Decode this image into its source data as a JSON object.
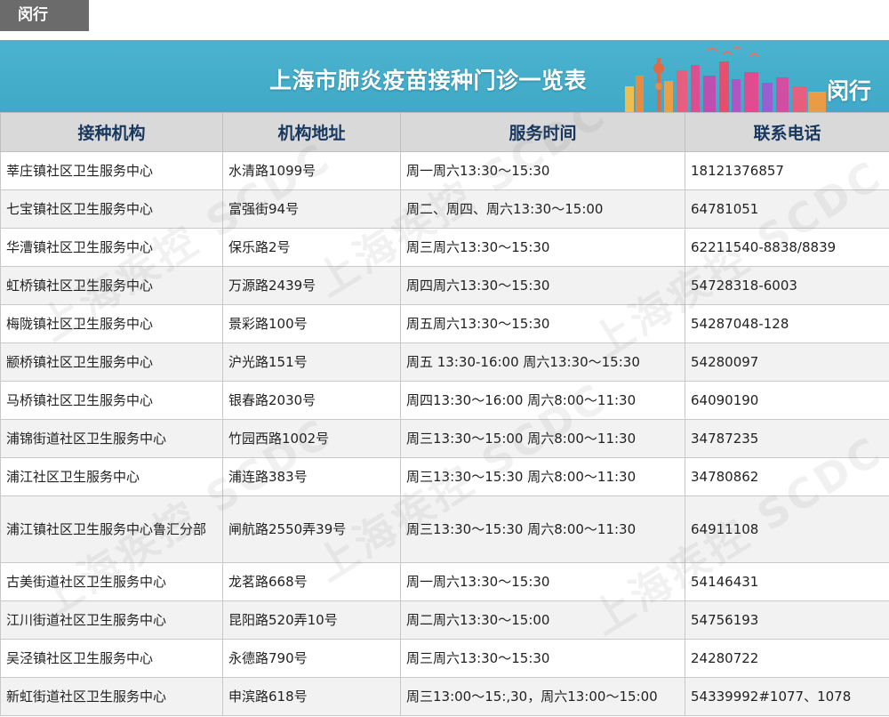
{
  "tag": {
    "label": "闵行"
  },
  "banner": {
    "title": "上海市肺炎疫苗接种门诊一览表",
    "district": "闵行"
  },
  "table": {
    "headers": [
      "接种机构",
      "机构地址",
      "服务时间",
      "联系电话"
    ],
    "rows": [
      [
        "莘庄镇社区卫生服务中心",
        "水清路1099号",
        "周一周六13:30～15:30",
        "18121376857"
      ],
      [
        "七宝镇社区卫生服务中心",
        "富强街94号",
        "周二、周四、周六13:30～15:00",
        "64781051"
      ],
      [
        "华漕镇社区卫生服务中心",
        "保乐路2号",
        "周三周六13:30～15:30",
        "62211540-8838/8839"
      ],
      [
        "虹桥镇社区卫生服务中心",
        "万源路2439号",
        "周四周六13:30～15:30",
        "54728318-6003"
      ],
      [
        "梅陇镇社区卫生服务中心",
        "景彩路100号",
        "周五周六13:30～15:30",
        "54287048-128"
      ],
      [
        "颛桥镇社区卫生服务中心",
        "沪光路151号",
        "周五 13:30-16:00 周六13:30～15:30",
        "54280097"
      ],
      [
        "马桥镇社区卫生服务中心",
        "银春路2030号",
        "周四13:30～16:00 周六8:00～11:30",
        "64090190"
      ],
      [
        "浦锦街道社区卫生服务中心",
        "竹园西路1002号",
        "周三13:30～15:00 周六8:00～11:30",
        "34787235"
      ],
      [
        "浦江社区卫生服务中心",
        "浦连路383号",
        "周三13:30～15:30 周六8:00～11:30",
        "34780862"
      ],
      [
        "浦江镇社区卫生服务中心鲁汇分部",
        "闸航路2550弄39号",
        "周三13:30～15:30 周六8:00～11:30",
        "64911108"
      ],
      [
        "古美街道社区卫生服务中心",
        "龙茗路668号",
        "周一周六13:30～15:30",
        "54146431"
      ],
      [
        "江川街道社区卫生服务中心",
        "昆阳路520弄10号",
        "周二周六13:30～15:00",
        "54756193"
      ],
      [
        "吴泾镇社区卫生服务中心",
        "永德路790号",
        "周三周六13:30～15:30",
        "24280722"
      ],
      [
        "新虹街道社区卫生服务中心",
        "申滨路618号",
        "周三13:00～15:,30，周六13:00～15:00",
        "54339992#1077、1078"
      ]
    ]
  },
  "watermark": {
    "text": "上海疾控 SCDC"
  },
  "colors": {
    "banner": "#4bb3cf",
    "header_bg": "#d9d9d9",
    "header_text": "#17375e",
    "tag_bg": "#6b6b6b"
  }
}
